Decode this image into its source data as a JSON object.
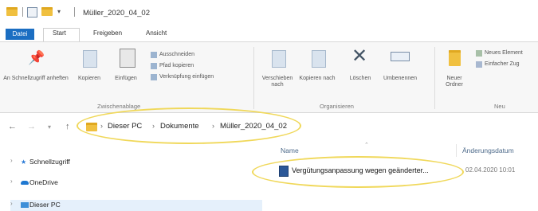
{
  "window": {
    "title": "Müller_2020_04_02"
  },
  "ribbon_tabs": [
    "Datei",
    "Start",
    "Freigeben",
    "Ansicht"
  ],
  "ribbon": {
    "pin": "An Schnellzugriff anheften",
    "copy": "Kopieren",
    "paste": "Einfügen",
    "cut": "Ausschneiden",
    "copy_path": "Pfad kopieren",
    "paste_shortcut": "Verknüpfung einfügen",
    "group_clipboard": "Zwischenablage",
    "move_to": "Verschieben nach",
    "copy_to": "Kopieren nach",
    "delete": "Löschen",
    "rename": "Umbenennen",
    "group_organize": "Organisieren",
    "new_folder": "Neuer Ordner",
    "new_item": "Neues Element",
    "easy_access": "Einfacher Zug",
    "group_new": "Neu"
  },
  "breadcrumb": [
    "Dieser PC",
    "Dokumente",
    "Müller_2020_04_02"
  ],
  "nav_pane": [
    "Schnellzugriff",
    "OneDrive",
    "Dieser PC"
  ],
  "columns": {
    "name": "Name",
    "date": "Änderungsdatum"
  },
  "files": [
    {
      "name": "Vergütungsanpassung wegen geänderter...",
      "date": "02.04.2020 10:01"
    }
  ],
  "colors": {
    "file_tab": "#1b6ec2",
    "folder": "#f0c040",
    "highlight": "#f0d85a"
  }
}
